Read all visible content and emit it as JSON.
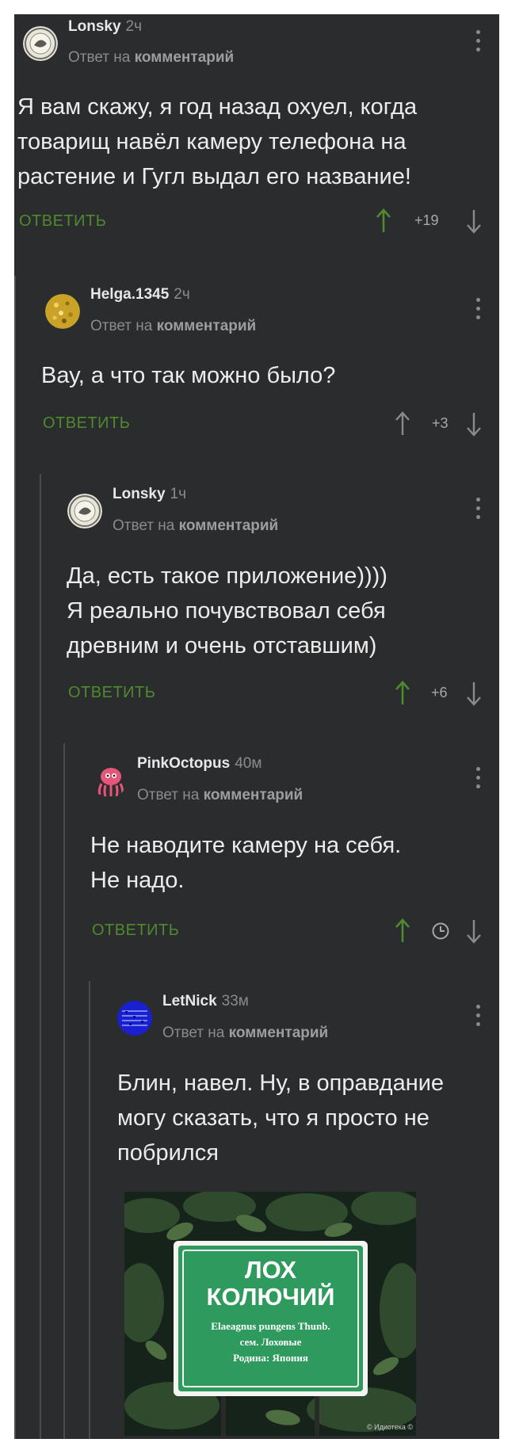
{
  "reply_context_prefix": "Ответ на",
  "reply_context_target": "комментарий",
  "reply_label": "ОТВЕТИТЬ",
  "comments": [
    {
      "author": "Lonsky",
      "time": "2ч",
      "text": [
        "Я вам скажу, я год назад охуел, когда",
        "товарищ навёл камеру телефона на",
        "растение и Гугл выдал его название!"
      ],
      "score": "+19",
      "avatar": "emblem-avatar"
    },
    {
      "author": "Helga.1345",
      "time": "2ч",
      "text": [
        "Вау, а что так можно было?"
      ],
      "score": "+3",
      "avatar": "gold-glitter-avatar"
    },
    {
      "author": "Lonsky",
      "time": "1ч",
      "text": [
        "Да, есть такое приложение))))",
        "Я реально почувствовал себя",
        "древним и очень отставшим)"
      ],
      "score": "+6",
      "avatar": "emblem-avatar"
    },
    {
      "author": "PinkOctopus",
      "time": "40м",
      "text": [
        "Не наводите камеру на себя.",
        "Не надо."
      ],
      "score": "",
      "avatar": "pink-octopus-avatar"
    },
    {
      "author": "LetNick",
      "time": "33м",
      "text": [
        "Блин, навел. Ну, в оправдание",
        "могу сказать, что я просто не",
        "побрился"
      ],
      "score": "",
      "avatar": "blue-pattern-avatar"
    }
  ],
  "image": {
    "sign_title_1": "ЛОХ",
    "sign_title_2": "КОЛЮЧИЙ",
    "sign_latin": "Elaeagnus pungens Thunb.",
    "sign_family": "сем. Лоховые",
    "sign_origin": "Родина: Япония",
    "watermark": "© Идиотека ©",
    "sign_color": "#2f9a5e"
  },
  "colors": {
    "background": "#2b2c2e",
    "reply_green": "#4f8a2e",
    "upvote_green": "#4f8a2e"
  }
}
